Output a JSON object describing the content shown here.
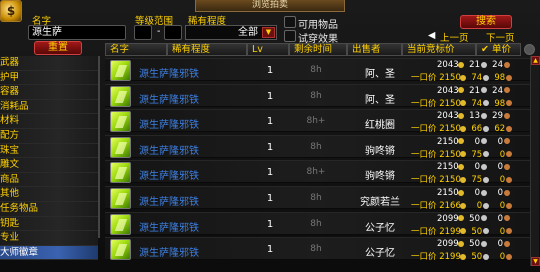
{
  "window": {
    "title": "浏览拍卖"
  },
  "filters": {
    "name_label": "名字",
    "name_value": "源生萨",
    "level_label": "等级范围",
    "level_sep": "-",
    "rarity_label": "稀有程度",
    "rarity_value": "全部",
    "usable_label": "可用物品",
    "preview_label": "试穿效果",
    "search_button": "搜索",
    "reset_button": "重置",
    "prev_label": "上一页",
    "next_label": "下一页"
  },
  "categories": [
    "武器",
    "护甲",
    "容器",
    "消耗品",
    "材料",
    "配方",
    "珠宝",
    "雕文",
    "商品",
    "其他",
    "任务物品",
    "钥匙",
    "专业",
    "大师徽章"
  ],
  "selected_category_index": 13,
  "columns": {
    "name": "名字",
    "rarity": "稀有程度",
    "level": "Lv",
    "time": "剩余时间",
    "seller": "出售者",
    "bid": "当前竞标价",
    "unit": "单价"
  },
  "buyout_label": "一口价",
  "rows": [
    {
      "name": "源生萨隆邪铁",
      "level": "1",
      "time": "8h",
      "seller": "阿、圣",
      "bid": {
        "g": "2043",
        "s": "21",
        "c": "24"
      },
      "buy": {
        "g": "2150",
        "s": "74",
        "c": "98"
      }
    },
    {
      "name": "源生萨隆邪铁",
      "level": "1",
      "time": "8h",
      "seller": "阿、圣",
      "bid": {
        "g": "2043",
        "s": "21",
        "c": "24"
      },
      "buy": {
        "g": "2150",
        "s": "74",
        "c": "98"
      }
    },
    {
      "name": "源生萨隆邪铁",
      "level": "1",
      "time": "8h+",
      "seller": "红桃圈",
      "bid": {
        "g": "2043",
        "s": "13",
        "c": "29"
      },
      "buy": {
        "g": "2150",
        "s": "66",
        "c": "62"
      }
    },
    {
      "name": "源生萨隆邪铁",
      "level": "1",
      "time": "8h",
      "seller": "驹咚锵",
      "bid": {
        "g": "2150",
        "s": "0",
        "c": "0"
      },
      "buy": {
        "g": "2150",
        "s": "75",
        "c": "0"
      }
    },
    {
      "name": "源生萨隆邪铁",
      "level": "1",
      "time": "8h+",
      "seller": "驹咚锵",
      "bid": {
        "g": "2150",
        "s": "0",
        "c": "0"
      },
      "buy": {
        "g": "2150",
        "s": "75",
        "c": "0"
      }
    },
    {
      "name": "源生萨隆邪铁",
      "level": "1",
      "time": "8h",
      "seller": "究颜若兰",
      "bid": {
        "g": "2150",
        "s": "0",
        "c": "0"
      },
      "buy": {
        "g": "2166",
        "s": "0",
        "c": "0"
      }
    },
    {
      "name": "源生萨隆邪铁",
      "level": "1",
      "time": "8h",
      "seller": "公子忆",
      "bid": {
        "g": "2099",
        "s": "50",
        "c": "0"
      },
      "buy": {
        "g": "2199",
        "s": "50",
        "c": "0"
      }
    },
    {
      "name": "源生萨隆邪铁",
      "level": "1",
      "time": "8h",
      "seller": "公子忆",
      "bid": {
        "g": "2099",
        "s": "50",
        "c": "0"
      },
      "buy": {
        "g": "2199",
        "s": "50",
        "c": "0"
      }
    }
  ],
  "colors": {
    "gold": "#ffd100",
    "item_name": "#3d7fe0",
    "selected_category": "#3a62b0"
  }
}
